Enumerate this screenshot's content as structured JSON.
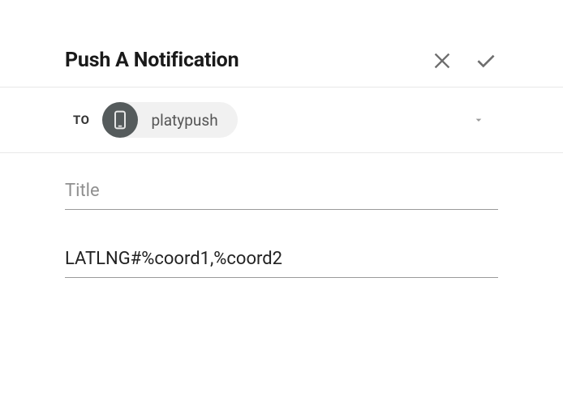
{
  "header": {
    "title": "Push A Notification"
  },
  "to": {
    "label": "TO",
    "chip_label": "platypush"
  },
  "fields": {
    "title_placeholder": "Title",
    "title_value": "",
    "body_value": "LATLNG#%coord1,%coord2"
  },
  "icons": {
    "close": "close-icon",
    "confirm": "check-icon",
    "device": "phone-icon",
    "dropdown": "chevron-down-icon"
  }
}
